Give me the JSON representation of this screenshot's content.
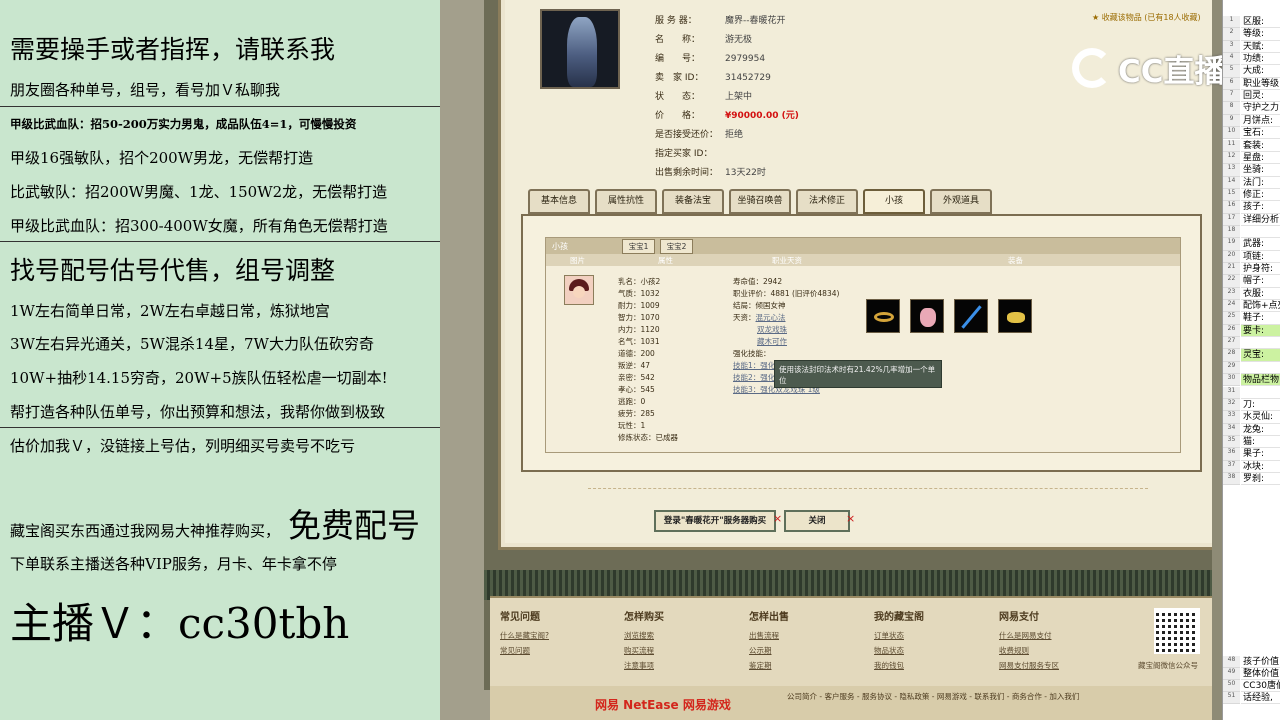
{
  "overlay": {
    "line1": "需要操手或者指挥，请联系我",
    "line2": "朋友圈各种单号，组号，看号加Ｖ私聊我",
    "line3": "甲级比武血队：招50-200万实力男鬼，成品队伍4=1，可慢慢投资",
    "line4": "甲级16强敏队，招个200W男龙，无偿帮打造",
    "line5": "比武敏队：招200W男魔、1龙、150W2龙，无偿帮打造",
    "line6": "甲级比武血队：招300-400W女魔，所有角色无偿帮打造",
    "line7": "找号配号估号代售，组号调整",
    "line8": "1W左右简单日常，2W左右卓越日常，炼狱地宫",
    "line9": "3W左右异光通关，5W混杀14星，7W大力队伍砍穷奇",
    "line10": "10W+抽秒14.15穷奇，20W+5族队伍轻松虐一切副本!",
    "line11": "帮打造各种队伍单号，你出预算和想法，我帮你做到极致",
    "line12": "估价加我Ｖ，没链接上号估，列明细买号卖号不吃亏",
    "line13a": "藏宝阁买东西通过我网易大神推荐购买，",
    "line13b": "免费配号",
    "line14": "下单联系主播送各种VIP服务，月卡、年卡拿不停",
    "line15": "主播Ｖ：cc30tbh"
  },
  "listing": {
    "rows": [
      {
        "k": "服 务 器：",
        "v": "魔界--春暖花开"
      },
      {
        "k": "名　　称：",
        "v": "游无极"
      },
      {
        "k": "编　　号：",
        "v": "2979954"
      },
      {
        "k": "卖　家 ID：",
        "v": "31452729"
      },
      {
        "k": "状　　态：",
        "v": "上架中"
      },
      {
        "k": "价　　格：",
        "v": "¥90000.00 (元)"
      },
      {
        "k": "是否接受还价：",
        "v": "拒绝"
      },
      {
        "k": "指定买家 ID：",
        "v": ""
      },
      {
        "k": "出售剩余时间：",
        "v": "13天22时"
      }
    ],
    "favorite": "收藏该物品 (已有18人收藏)"
  },
  "tabs": [
    "基本信息",
    "属性抗性",
    "装备法宝",
    "坐骑召唤兽",
    "法术修正",
    "小孩",
    "外观道具"
  ],
  "child": {
    "section_title": "小孩",
    "sub_tabs": [
      "宝宝1",
      "宝宝2"
    ],
    "columns": [
      "图片",
      "属性",
      "职业天资",
      "装备"
    ],
    "stats_left": [
      "乳名：小孩2",
      "气质：1032",
      "耐力：1009",
      "智力：1070",
      "内力：1120",
      "名气：1031",
      "道德：200",
      "叛逆：47",
      "亲密：542",
      "孝心：545",
      "逃跑：0",
      "疲劳：285",
      "玩性：1",
      "修炼状态：已成器"
    ],
    "stats_right": {
      "life": "寿命值：2942",
      "score": "职业评价：4881 (旧评价4834)",
      "result": "结局：倾国女神",
      "talent_label": "天资：",
      "talents": [
        "混元心法",
        "双龙戏珠",
        "藏木可作"
      ],
      "skill_label": "强化技能：",
      "skills": [
        "技能1：强化混元...",
        "技能2：强化混元心法 1级",
        "技能3：强化双龙戏珠 1级"
      ]
    },
    "tooltip": "使用该法封印法术时有21.42%几率增加一个单位"
  },
  "buttons": {
    "login": "登录\"春暖花开\"服务器购买",
    "close": "关闭",
    "x": "×"
  },
  "footer": {
    "cols": [
      {
        "title": "常见问题",
        "links": [
          "什么是藏宝阁?",
          "常见问题"
        ]
      },
      {
        "title": "怎样购买",
        "links": [
          "浏览搜索",
          "购买流程",
          "注意事项"
        ]
      },
      {
        "title": "怎样出售",
        "links": [
          "出售流程",
          "公示期",
          "鉴定期"
        ]
      },
      {
        "title": "我的藏宝阁",
        "links": [
          "订单状态",
          "物品状态",
          "我的钱包"
        ]
      },
      {
        "title": "网易支付",
        "links": [
          "什么是网易支付",
          "收费规则",
          "网易支付服务专区"
        ]
      }
    ],
    "qr_label": "藏宝阁微信公众号",
    "brand_left": "网易  NetEase  网易游戏",
    "brand_links": "公司简介 - 客户服务 - 服务协议 - 隐私政策 - 网易游戏 - 联系我们 - 商务合作 - 加入我们"
  },
  "logo": {
    "text": "CC直播"
  },
  "sheet": {
    "rows": [
      {
        "n": "1",
        "t": "区服:",
        "g": false
      },
      {
        "n": "2",
        "t": "等级:",
        "g": false
      },
      {
        "n": "3",
        "t": "天赋:",
        "g": false
      },
      {
        "n": "4",
        "t": "功绩:",
        "g": false
      },
      {
        "n": "5",
        "t": "大成:",
        "g": false
      },
      {
        "n": "6",
        "t": "职业等级",
        "g": false
      },
      {
        "n": "7",
        "t": "回灵:",
        "g": false
      },
      {
        "n": "8",
        "t": "守护之力",
        "g": false
      },
      {
        "n": "9",
        "t": "月饼点:",
        "g": false
      },
      {
        "n": "10",
        "t": "宝石:",
        "g": false
      },
      {
        "n": "11",
        "t": "套装:",
        "g": false
      },
      {
        "n": "12",
        "t": "星盘:",
        "g": false
      },
      {
        "n": "13",
        "t": "坐骑:",
        "g": false
      },
      {
        "n": "14",
        "t": "法门:",
        "g": false
      },
      {
        "n": "15",
        "t": "修正:",
        "g": false
      },
      {
        "n": "16",
        "t": "孩子:",
        "g": false
      },
      {
        "n": "17",
        "t": "详细分析",
        "g": false
      },
      {
        "n": "18",
        "t": "",
        "g": false
      },
      {
        "n": "19",
        "t": "武器:",
        "g": false
      },
      {
        "n": "20",
        "t": "项链:",
        "g": false
      },
      {
        "n": "21",
        "t": "护身符:",
        "g": false
      },
      {
        "n": "22",
        "t": "帽子:",
        "g": false
      },
      {
        "n": "23",
        "t": "衣服:",
        "g": false
      },
      {
        "n": "24",
        "t": "配饰+点亮",
        "g": false
      },
      {
        "n": "25",
        "t": "鞋子:",
        "g": false
      },
      {
        "n": "26",
        "t": "要卡:",
        "g": true
      },
      {
        "n": "27",
        "t": "",
        "g": false
      },
      {
        "n": "28",
        "t": "灵宝:",
        "g": true
      },
      {
        "n": "29",
        "t": "",
        "g": false
      },
      {
        "n": "30",
        "t": "物品栏物",
        "g": true
      },
      {
        "n": "31",
        "t": "",
        "g": false
      },
      {
        "n": "32",
        "t": "刀:",
        "g": false
      },
      {
        "n": "33",
        "t": "水灵仙:",
        "g": false
      },
      {
        "n": "34",
        "t": "龙兔:",
        "g": false
      },
      {
        "n": "35",
        "t": "猫:",
        "g": false
      },
      {
        "n": "36",
        "t": "果子:",
        "g": false
      },
      {
        "n": "37",
        "t": "冰块:",
        "g": false
      },
      {
        "n": "38",
        "t": "罗刹:",
        "g": false
      }
    ],
    "bottom_rows": [
      {
        "n": "48",
        "t": "孩子价值"
      },
      {
        "n": "49",
        "t": "整体价值"
      },
      {
        "n": "50",
        "t": "CC30唐伯"
      },
      {
        "n": "51",
        "t": "话经验,"
      }
    ]
  }
}
